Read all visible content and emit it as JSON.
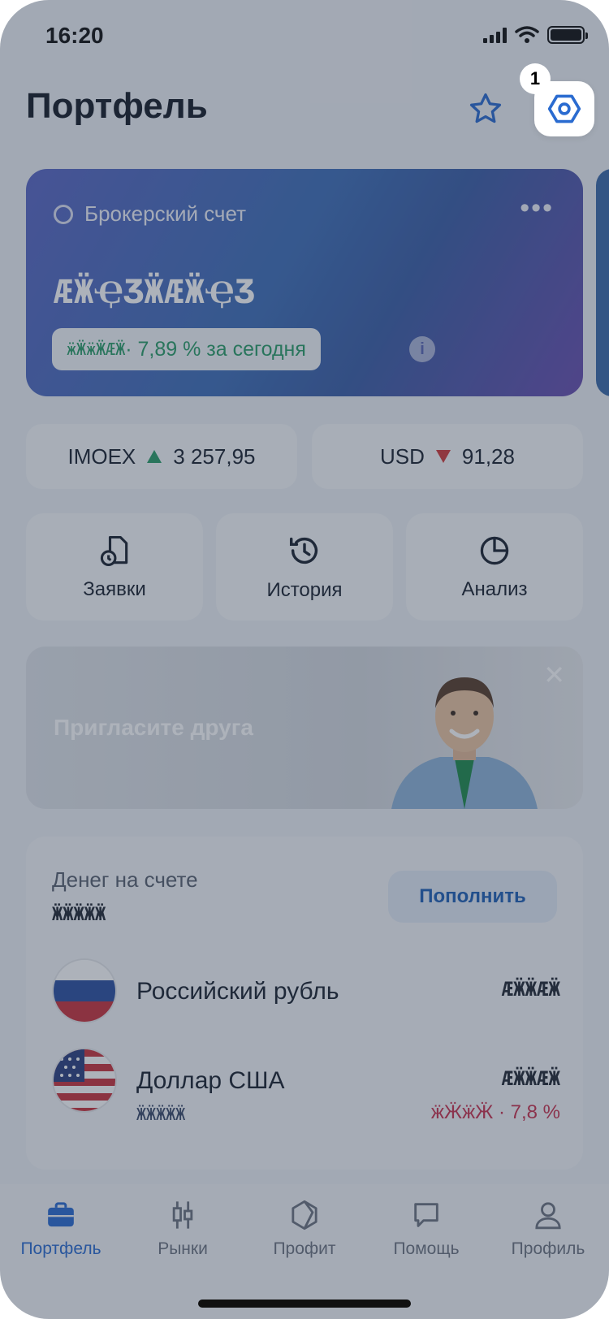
{
  "status_bar": {
    "time": "16:20"
  },
  "header": {
    "title": "Портфель",
    "step_badge": "1"
  },
  "account_card": {
    "label": "Брокерский счет",
    "balance": "ӔӜҾӠӜӔӜҾӠ",
    "change_amount": "ӝӜӝӜӔӜ",
    "change_text": " · 7,89 % за сегодня",
    "info": "i"
  },
  "tickers": [
    {
      "name": "IMOEX",
      "value": "3 257,95",
      "direction": "up"
    },
    {
      "name": "USD",
      "value": "91,28",
      "direction": "down"
    }
  ],
  "actions": [
    {
      "label": "Заявки",
      "icon": "orders-icon"
    },
    {
      "label": "История",
      "icon": "history-icon"
    },
    {
      "label": "Анализ",
      "icon": "pie-chart-icon"
    }
  ],
  "promo": {
    "text": "Пригласите друга",
    "close": "✕"
  },
  "money": {
    "label": "Денег на счете",
    "amount": "ӜӜӜӜӜ",
    "topup_label": "Пополнить",
    "currencies": [
      {
        "name": "Российский рубль",
        "amount": "ӔӜӜӔӜ",
        "sub": "",
        "change": ""
      },
      {
        "name": "Доллар США",
        "amount": "ӔӜӜӔӜ",
        "sub": "ӜӜӜӜӜ",
        "change": "ӝӜӝӜ · 7,8 %"
      }
    ]
  },
  "tabbar": {
    "items": [
      {
        "label": "Портфель",
        "icon": "briefcase-icon",
        "active": true
      },
      {
        "label": "Рынки",
        "icon": "candles-icon",
        "active": false
      },
      {
        "label": "Профит",
        "icon": "hexagon-icon",
        "active": false
      },
      {
        "label": "Помощь",
        "icon": "chat-icon",
        "active": false
      },
      {
        "label": "Профиль",
        "icon": "user-icon",
        "active": false
      }
    ]
  },
  "colors": {
    "accent": "#2a6bd0",
    "positive": "#2a9d68",
    "negative": "#d13a3a",
    "overlay": "#28344a"
  }
}
